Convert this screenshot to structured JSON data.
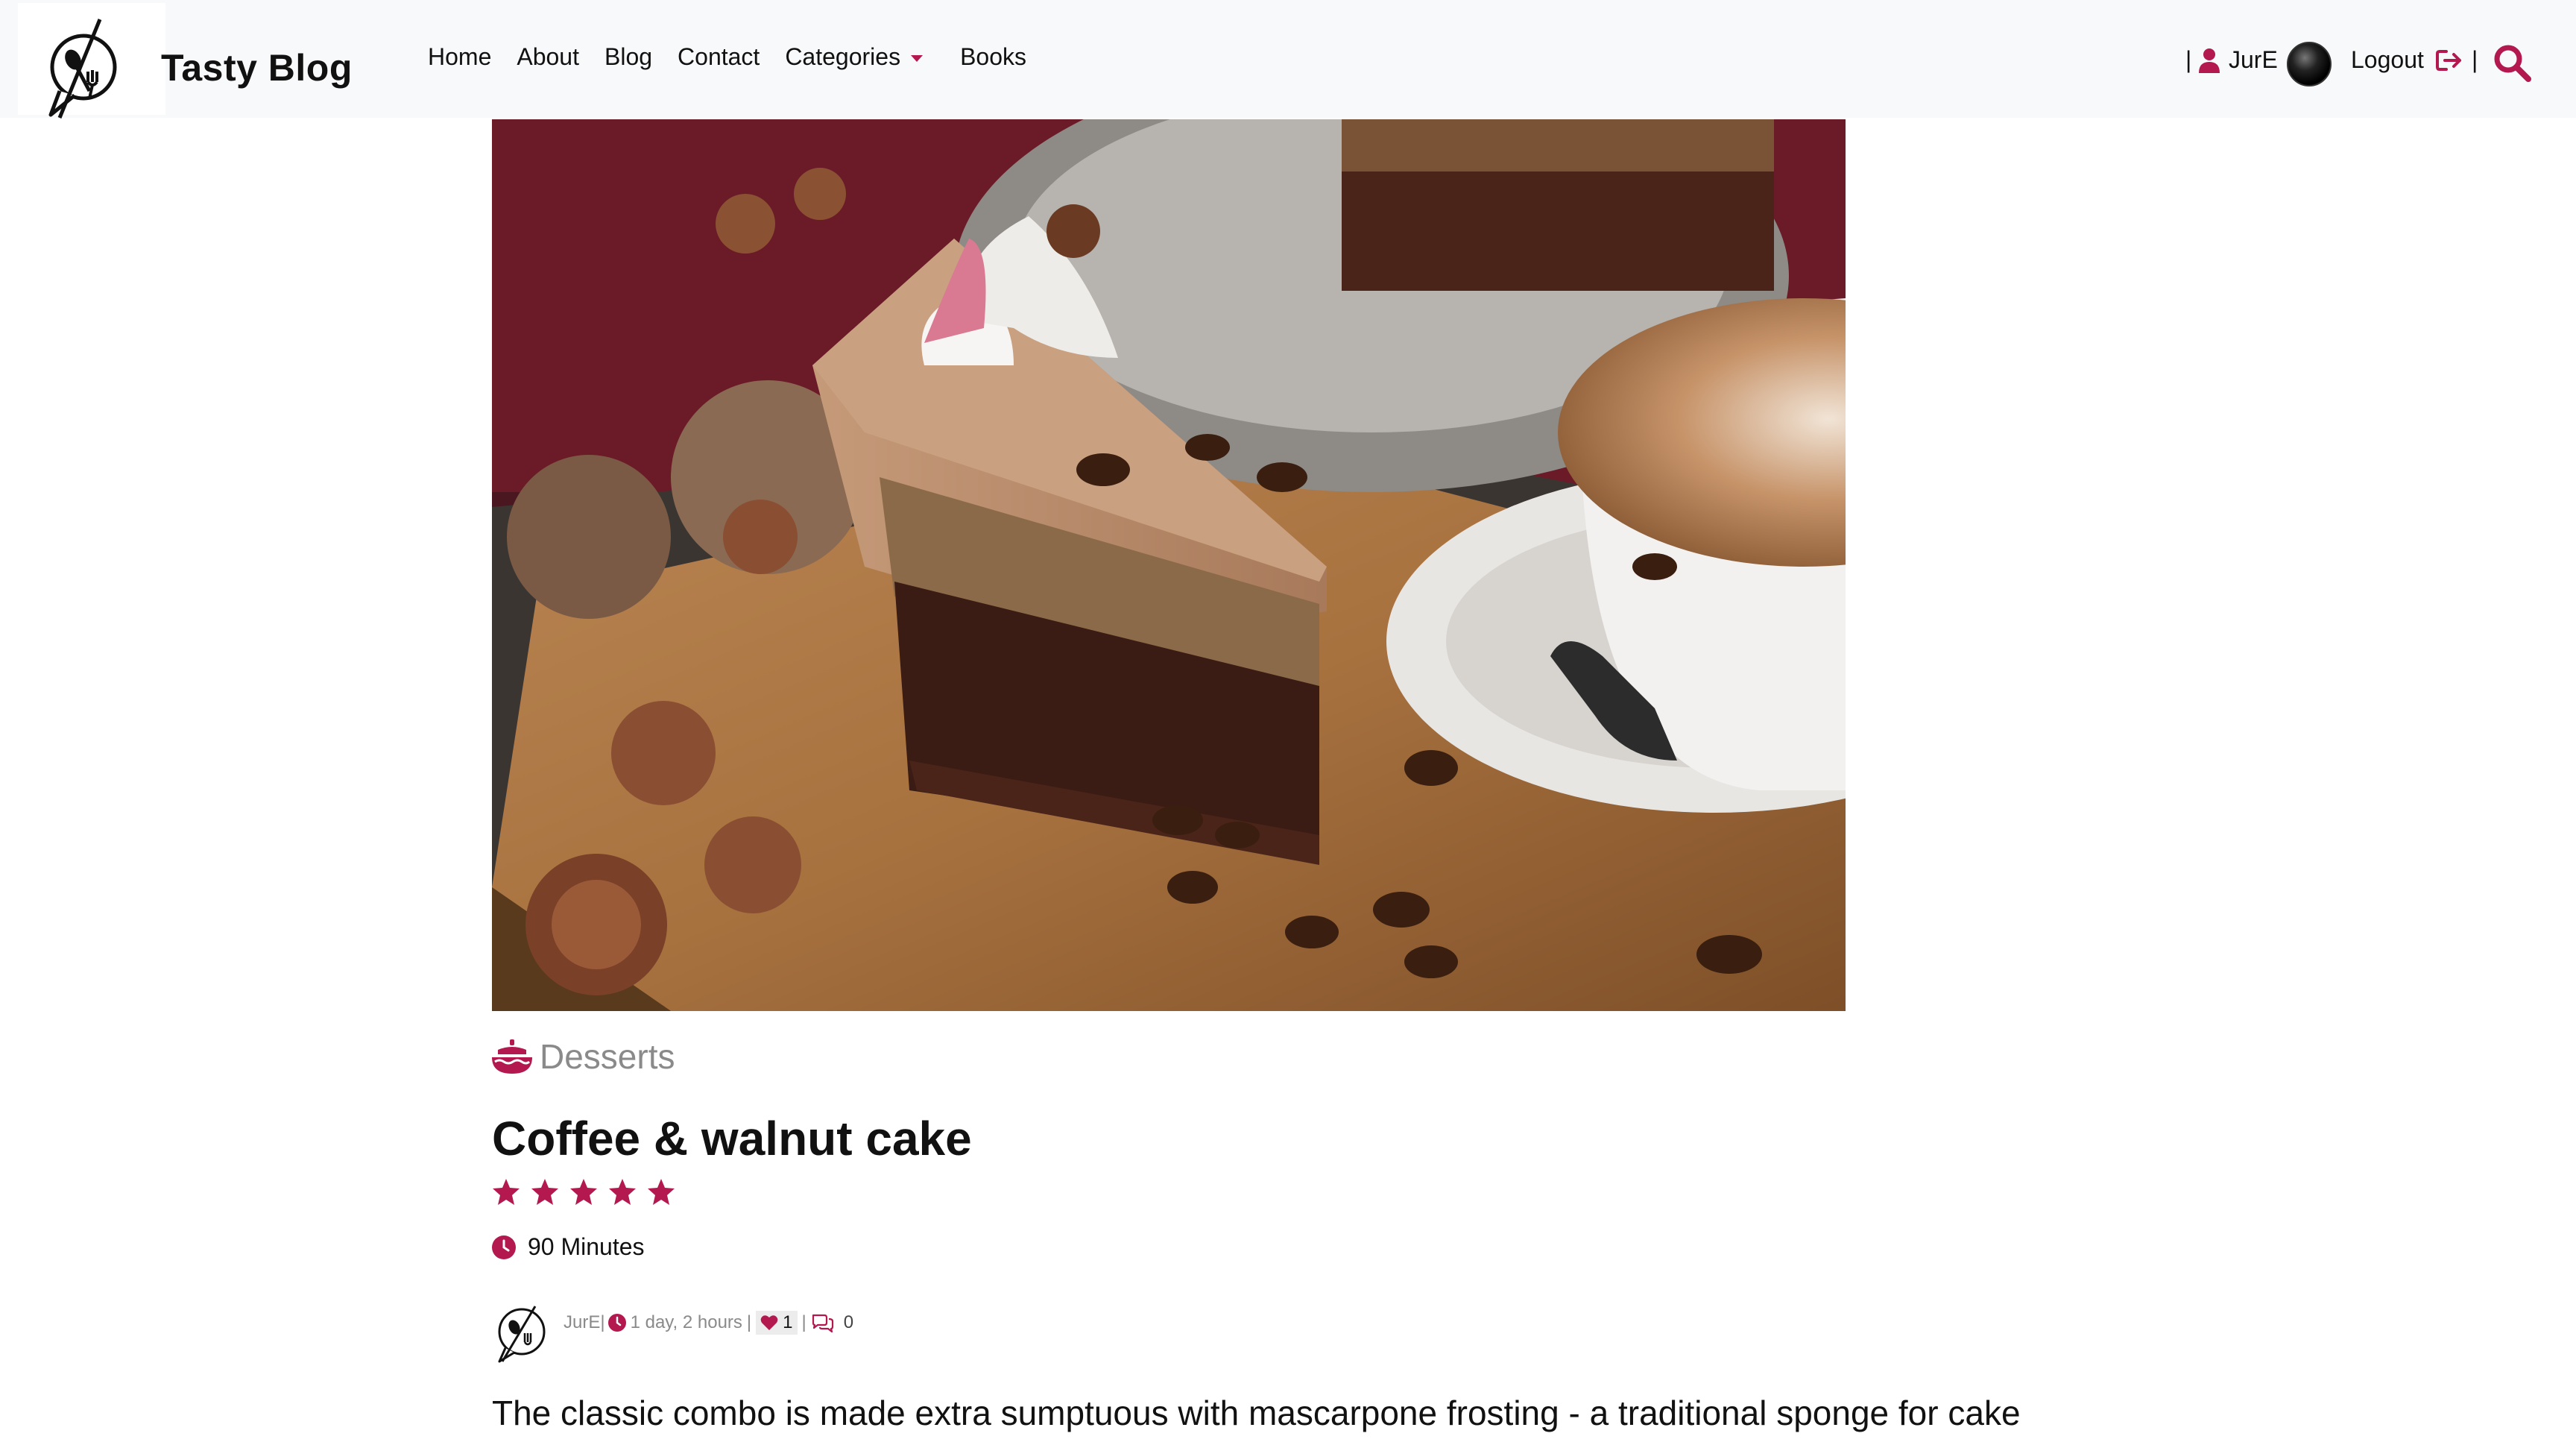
{
  "brand": {
    "name": "Tasty Blog",
    "accent": "#b3194f"
  },
  "nav": {
    "links": [
      "Home",
      "About",
      "Blog",
      "Contact"
    ],
    "categories_label": "Categories",
    "books_label": "Books"
  },
  "user": {
    "name": "JurE",
    "logout_label": "Logout"
  },
  "post": {
    "category": "Desserts",
    "title": "Coffee & walnut cake",
    "rating": 5,
    "rating_max": 5,
    "cook_time": "90 Minutes",
    "author": "JurE",
    "posted": "1 day, 2 hours",
    "likes": "1",
    "comments": "0",
    "excerpt": "The classic combo is made extra sumptuous with mascarpone frosting - a traditional sponge for cake"
  },
  "icons": {
    "brand": "logo-icon",
    "user": "user-icon",
    "logout": "logout-icon",
    "search": "search-icon",
    "category": "cake-icon",
    "rating": "star-icon",
    "time": "clock-icon",
    "like": "heart-icon",
    "comment": "comment-icon"
  }
}
